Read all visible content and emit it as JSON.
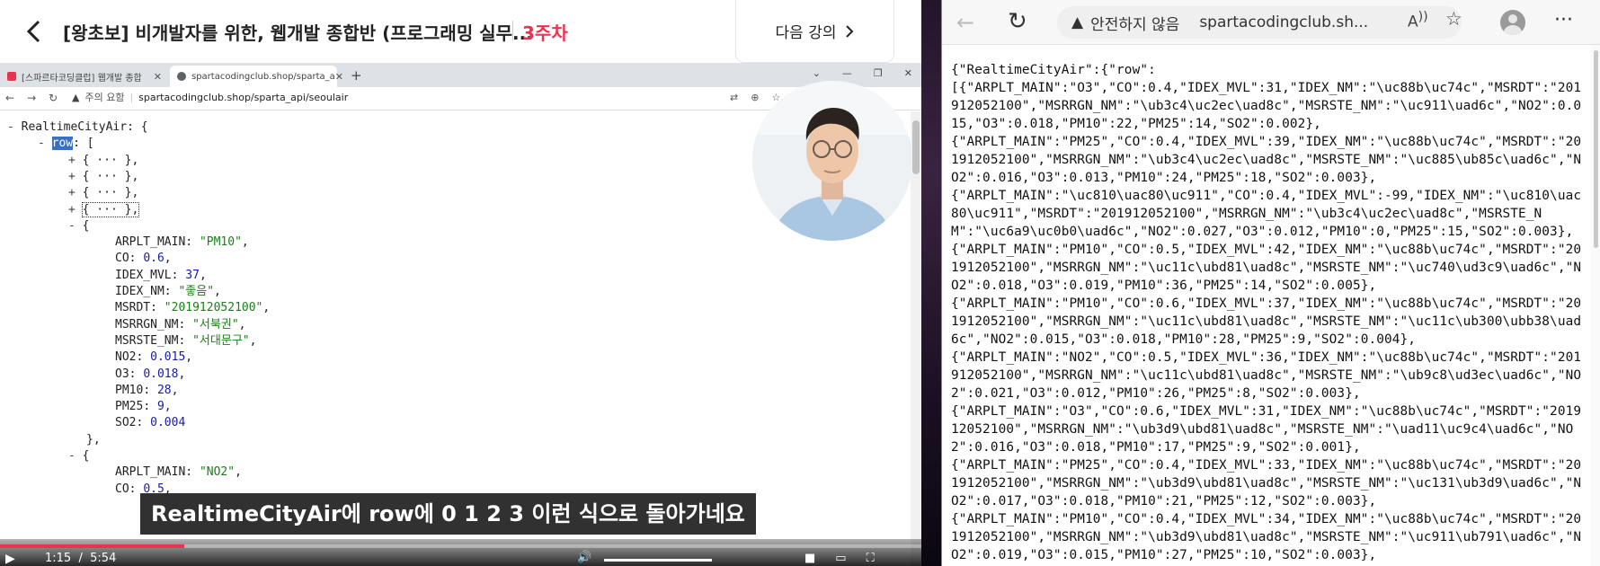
{
  "player": {
    "course_title": "[왕초보] 비개발자를 위한, 웹개발 종합반 (프로그래밍 실무...",
    "week": "3주차",
    "next_lesson": "다음 강의",
    "subtitle": "RealtimeCityAir에 row에 0 1 2 3 이런 식으로 돌아가네요",
    "time_current": "1:15",
    "time_total": "5:54",
    "progress": 0.2
  },
  "inner_browser": {
    "tabs": [
      {
        "label": "[스파르타코딩클럽] 웹개발 종합",
        "favicon_color": "#e8344e"
      },
      {
        "label": "spartacodingclub.shop/sparta_a",
        "favicon_color": "#5f6368"
      }
    ],
    "security": "주의 요함",
    "url": "spartacodingclub.shop/sparta_api/seoulair"
  },
  "json_tree": {
    "root_key": "RealtimeCityAir",
    "row_key": "row",
    "collapsed_placeholder": "{ ··· },",
    "expanded": [
      {
        "key": "ARPLT_MAIN",
        "value": "\"PM10\"",
        "type": "str"
      },
      {
        "key": "CO",
        "value": "0.6",
        "type": "num"
      },
      {
        "key": "IDEX_MVL",
        "value": "37",
        "type": "num"
      },
      {
        "key": "IDEX_NM",
        "value": "\"좋음\"",
        "type": "str"
      },
      {
        "key": "MSRDT",
        "value": "\"201912052100\"",
        "type": "str"
      },
      {
        "key": "MSRRGN_NM",
        "value": "\"서북권\"",
        "type": "str"
      },
      {
        "key": "MSRSTE_NM",
        "value": "\"서대문구\"",
        "type": "str"
      },
      {
        "key": "NO2",
        "value": "0.015",
        "type": "num"
      },
      {
        "key": "O3",
        "value": "0.018",
        "type": "num"
      },
      {
        "key": "PM10",
        "value": "28",
        "type": "num"
      },
      {
        "key": "PM25",
        "value": "9",
        "type": "num"
      },
      {
        "key": "SO2",
        "value": "0.004",
        "type": "num",
        "last": true
      }
    ],
    "next_key": "ARPLT_MAIN",
    "next_value": "\"NO2\"",
    "next_key2": "CO",
    "next_value2": "0.5"
  },
  "right_browser": {
    "security": "안전하지 않음",
    "url": "spartacodingclub.sh...",
    "raw_json": "{\"RealtimeCityAir\":{\"row\":\n[{\"ARPLT_MAIN\":\"O3\",\"CO\":0.4,\"IDEX_MVL\":31,\"IDEX_NM\":\"\\uc88b\\uc74c\",\"MSRDT\":\"201912052100\",\"MSRRGN_NM\":\"\\ub3c4\\uc2ec\\uad8c\",\"MSRSTE_NM\":\"\\uc911\\uad6c\",\"NO2\":0.015,\"O3\":0.018,\"PM10\":22,\"PM25\":14,\"SO2\":0.002},\n{\"ARPLT_MAIN\":\"PM25\",\"CO\":0.4,\"IDEX_MVL\":39,\"IDEX_NM\":\"\\uc88b\\uc74c\",\"MSRDT\":\"201912052100\",\"MSRRGN_NM\":\"\\ub3c4\\uc2ec\\uad8c\",\"MSRSTE_NM\":\"\\uc885\\ub85c\\uad6c\",\"NO2\":0.016,\"O3\":0.013,\"PM10\":24,\"PM25\":18,\"SO2\":0.003},\n{\"ARPLT_MAIN\":\"\\uc810\\uac80\\uc911\",\"CO\":0.4,\"IDEX_MVL\":-99,\"IDEX_NM\":\"\\uc810\\uac80\\uc911\",\"MSRDT\":\"201912052100\",\"MSRRGN_NM\":\"\\ub3c4\\uc2ec\\uad8c\",\"MSRSTE_NM\":\"\\uc6a9\\uc0b0\\uad6c\",\"NO2\":0.027,\"O3\":0.012,\"PM10\":0,\"PM25\":15,\"SO2\":0.003},\n{\"ARPLT_MAIN\":\"PM10\",\"CO\":0.5,\"IDEX_MVL\":42,\"IDEX_NM\":\"\\uc88b\\uc74c\",\"MSRDT\":\"201912052100\",\"MSRRGN_NM\":\"\\uc11c\\ubd81\\uad8c\",\"MSRSTE_NM\":\"\\uc740\\ud3c9\\uad6c\",\"NO2\":0.018,\"O3\":0.019,\"PM10\":36,\"PM25\":14,\"SO2\":0.005},\n{\"ARPLT_MAIN\":\"PM10\",\"CO\":0.6,\"IDEX_MVL\":37,\"IDEX_NM\":\"\\uc88b\\uc74c\",\"MSRDT\":\"201912052100\",\"MSRRGN_NM\":\"\\uc11c\\ubd81\\uad8c\",\"MSRSTE_NM\":\"\\uc11c\\ub300\\ubb38\\uad6c\",\"NO2\":0.015,\"O3\":0.018,\"PM10\":28,\"PM25\":9,\"SO2\":0.004},\n{\"ARPLT_MAIN\":\"NO2\",\"CO\":0.5,\"IDEX_MVL\":36,\"IDEX_NM\":\"\\uc88b\\uc74c\",\"MSRDT\":\"201912052100\",\"MSRRGN_NM\":\"\\uc11c\\ubd81\\uad8c\",\"MSRSTE_NM\":\"\\ub9c8\\ud3ec\\uad6c\",\"NO2\":0.021,\"O3\":0.012,\"PM10\":26,\"PM25\":8,\"SO2\":0.003},\n{\"ARPLT_MAIN\":\"O3\",\"CO\":0.6,\"IDEX_MVL\":31,\"IDEX_NM\":\"\\uc88b\\uc74c\",\"MSRDT\":\"201912052100\",\"MSRRGN_NM\":\"\\ub3d9\\ubd81\\uad8c\",\"MSRSTE_NM\":\"\\uad11\\uc9c4\\uad6c\",\"NO2\":0.016,\"O3\":0.018,\"PM10\":17,\"PM25\":9,\"SO2\":0.001},\n{\"ARPLT_MAIN\":\"PM25\",\"CO\":0.4,\"IDEX_MVL\":33,\"IDEX_NM\":\"\\uc88b\\uc74c\",\"MSRDT\":\"201912052100\",\"MSRRGN_NM\":\"\\ub3d9\\ubd81\\uad8c\",\"MSRSTE_NM\":\"\\uc131\\ub3d9\\uad6c\",\"NO2\":0.017,\"O3\":0.018,\"PM10\":21,\"PM25\":12,\"SO2\":0.003},\n{\"ARPLT_MAIN\":\"PM10\",\"CO\":0.4,\"IDEX_MVL\":34,\"IDEX_NM\":\"\\uc88b\\uc74c\",\"MSRDT\":\"201912052100\",\"MSRRGN_NM\":\"\\ub3d9\\ubd81\\uad8c\",\"MSRSTE_NM\":\"\\uc911\\ub791\\uad6c\",\"NO2\":0.019,\"O3\":0.015,\"PM10\":27,\"PM25\":10,\"SO2\":0.003},"
  }
}
